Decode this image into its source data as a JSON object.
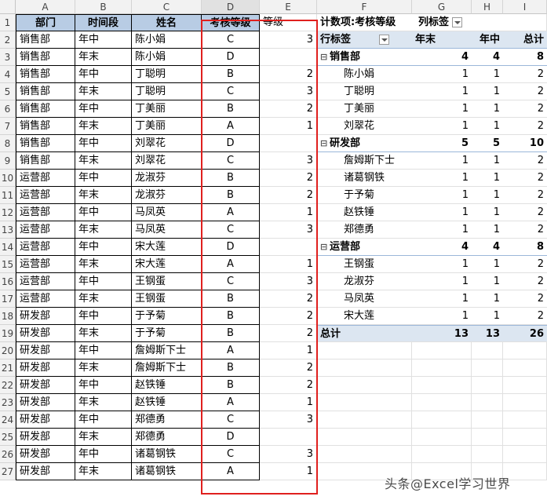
{
  "columns": [
    "A",
    "B",
    "C",
    "D",
    "E",
    "F",
    "G",
    "H",
    "I"
  ],
  "rows": [
    1,
    2,
    3,
    4,
    5,
    6,
    7,
    8,
    9,
    10,
    11,
    12,
    13,
    14,
    15,
    16,
    17,
    18,
    19,
    20,
    21,
    22,
    23,
    24,
    25,
    26,
    27
  ],
  "table": {
    "headers": [
      "部门",
      "时间段",
      "姓名",
      "考核等级",
      "等级"
    ],
    "data": [
      [
        "销售部",
        "年中",
        "陈小娟",
        "C",
        "3"
      ],
      [
        "销售部",
        "年末",
        "陈小娟",
        "D",
        ""
      ],
      [
        "销售部",
        "年中",
        "丁聪明",
        "B",
        "2"
      ],
      [
        "销售部",
        "年末",
        "丁聪明",
        "C",
        "3"
      ],
      [
        "销售部",
        "年中",
        "丁美丽",
        "B",
        "2"
      ],
      [
        "销售部",
        "年末",
        "丁美丽",
        "A",
        "1"
      ],
      [
        "销售部",
        "年中",
        "刘翠花",
        "D",
        ""
      ],
      [
        "销售部",
        "年末",
        "刘翠花",
        "C",
        "3"
      ],
      [
        "运营部",
        "年中",
        "龙淑芬",
        "B",
        "2"
      ],
      [
        "运营部",
        "年末",
        "龙淑芬",
        "B",
        "2"
      ],
      [
        "运营部",
        "年中",
        "马凤英",
        "A",
        "1"
      ],
      [
        "运营部",
        "年末",
        "马凤英",
        "C",
        "3"
      ],
      [
        "运营部",
        "年中",
        "宋大莲",
        "D",
        ""
      ],
      [
        "运营部",
        "年末",
        "宋大莲",
        "A",
        "1"
      ],
      [
        "运营部",
        "年中",
        "王钢蛋",
        "C",
        "3"
      ],
      [
        "运营部",
        "年末",
        "王钢蛋",
        "B",
        "2"
      ],
      [
        "研发部",
        "年中",
        "于予菊",
        "B",
        "2"
      ],
      [
        "研发部",
        "年末",
        "于予菊",
        "B",
        "2"
      ],
      [
        "研发部",
        "年中",
        "詹姆斯下士",
        "A",
        "1"
      ],
      [
        "研发部",
        "年末",
        "詹姆斯下士",
        "B",
        "2"
      ],
      [
        "研发部",
        "年中",
        "赵铁锤",
        "B",
        "2"
      ],
      [
        "研发部",
        "年末",
        "赵铁锤",
        "A",
        "1"
      ],
      [
        "研发部",
        "年中",
        "郑德勇",
        "C",
        "3"
      ],
      [
        "研发部",
        "年末",
        "郑德勇",
        "D",
        ""
      ],
      [
        "研发部",
        "年中",
        "诸葛钢铁",
        "C",
        "3"
      ],
      [
        "研发部",
        "年末",
        "诸葛钢铁",
        "A",
        "1"
      ]
    ]
  },
  "pivot": {
    "title": "计数项:考核等级",
    "col_label": "列标签",
    "row_label": "行标签",
    "col_headers": [
      "年末",
      "年中",
      "总计"
    ],
    "rows": [
      {
        "type": "group",
        "label": "销售部",
        "values": [
          "4",
          "4",
          "8"
        ]
      },
      {
        "type": "item",
        "label": "陈小娟",
        "values": [
          "1",
          "1",
          "2"
        ]
      },
      {
        "type": "item",
        "label": "丁聪明",
        "values": [
          "1",
          "1",
          "2"
        ]
      },
      {
        "type": "item",
        "label": "丁美丽",
        "values": [
          "1",
          "1",
          "2"
        ]
      },
      {
        "type": "item",
        "label": "刘翠花",
        "values": [
          "1",
          "1",
          "2"
        ]
      },
      {
        "type": "group",
        "label": "研发部",
        "values": [
          "5",
          "5",
          "10"
        ]
      },
      {
        "type": "item",
        "label": "詹姆斯下士",
        "values": [
          "1",
          "1",
          "2"
        ]
      },
      {
        "type": "item",
        "label": "诸葛钢铁",
        "values": [
          "1",
          "1",
          "2"
        ]
      },
      {
        "type": "item",
        "label": "于予菊",
        "values": [
          "1",
          "1",
          "2"
        ]
      },
      {
        "type": "item",
        "label": "赵铁锤",
        "values": [
          "1",
          "1",
          "2"
        ]
      },
      {
        "type": "item",
        "label": "郑德勇",
        "values": [
          "1",
          "1",
          "2"
        ]
      },
      {
        "type": "group",
        "label": "运营部",
        "values": [
          "4",
          "4",
          "8"
        ]
      },
      {
        "type": "item",
        "label": "王钢蛋",
        "values": [
          "1",
          "1",
          "2"
        ]
      },
      {
        "type": "item",
        "label": "龙淑芬",
        "values": [
          "1",
          "1",
          "2"
        ]
      },
      {
        "type": "item",
        "label": "马凤英",
        "values": [
          "1",
          "1",
          "2"
        ]
      },
      {
        "type": "item",
        "label": "宋大莲",
        "values": [
          "1",
          "1",
          "2"
        ]
      }
    ],
    "total_label": "总计",
    "total_values": [
      "13",
      "13",
      "26"
    ],
    "collapse_symbol": "⊟"
  },
  "watermark": "头条@Excel学习世界",
  "colors": {
    "header_fill": "#b8cce4",
    "pivot_header_fill": "#dce6f1",
    "highlight_border": "#e0201e"
  }
}
